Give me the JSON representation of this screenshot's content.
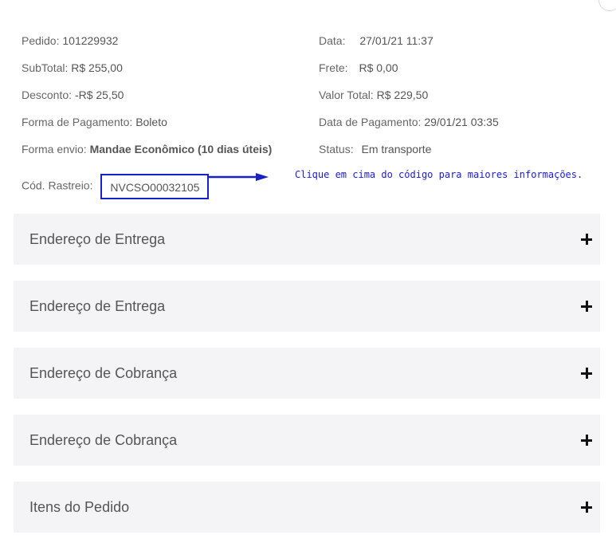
{
  "order": {
    "pedido_label": "Pedido:",
    "pedido_value": "101229932",
    "subtotal_label": "SubTotal:",
    "subtotal_value": "R$ 255,00",
    "desconto_label": "Desconto:",
    "desconto_value": "-R$ 25,50",
    "pagamento_label": "Forma de Pagamento:",
    "pagamento_value": "Boleto",
    "envio_label": "Forma envio:",
    "envio_value": "Mandae Econômico (10 dias úteis)",
    "rastreio_label": "Cód. Rastreio:",
    "rastreio_value": "NVCSO00032105",
    "data_label": "Data:",
    "data_value": "27/01/21 11:37",
    "frete_label": "Frete:",
    "frete_value": "R$ 0,00",
    "valor_total_label": "Valor Total:",
    "valor_total_value": "R$ 229,50",
    "data_pagamento_label": "Data de Pagamento:",
    "data_pagamento_value": "29/01/21 03:35",
    "status_label": "Status:",
    "status_value": "Em transporte"
  },
  "annotation": {
    "hint": "Clique em cima do código para maiores informações.",
    "arrow_color": "#1820c8"
  },
  "sections": [
    {
      "title": "Endereço de Entrega",
      "icon": "plus-icon"
    },
    {
      "title": "Endereço de Entrega",
      "icon": "plus-icon"
    },
    {
      "title": "Endereço de Cobrança",
      "icon": "plus-icon"
    },
    {
      "title": "Endereço de Cobrança",
      "icon": "plus-icon"
    },
    {
      "title": "Itens do Pedido",
      "icon": "plus-icon"
    }
  ]
}
